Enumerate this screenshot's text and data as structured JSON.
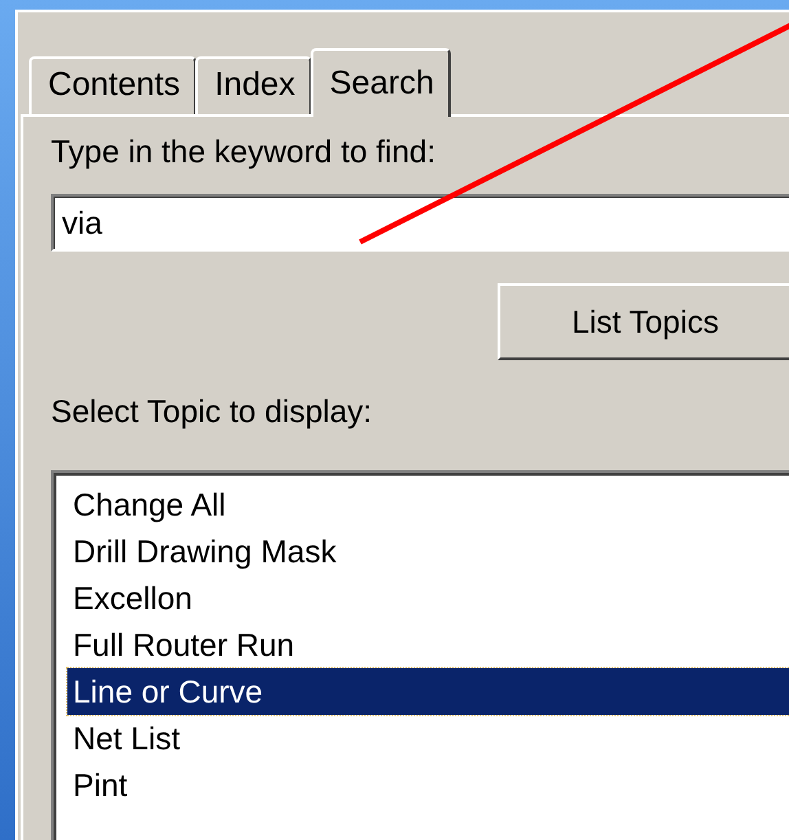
{
  "tabs": [
    {
      "label": "Contents",
      "selected": false
    },
    {
      "label": "Index",
      "selected": false
    },
    {
      "label": "Search",
      "selected": true
    }
  ],
  "keyword_label": "Type in the keyword to find:",
  "keyword_field": {
    "value": "via"
  },
  "list_button": "List Topics",
  "topic_label": "Select Topic to display:",
  "topics": [
    {
      "label": "Change All",
      "selected": false
    },
    {
      "label": "Drill Drawing Mask",
      "selected": false
    },
    {
      "label": "Excellon",
      "selected": false
    },
    {
      "label": "Full Router Run",
      "selected": false
    },
    {
      "label": "Line or Curve",
      "selected": true
    },
    {
      "label": "Net List",
      "selected": false
    },
    {
      "label": "Pint",
      "selected": false
    }
  ]
}
